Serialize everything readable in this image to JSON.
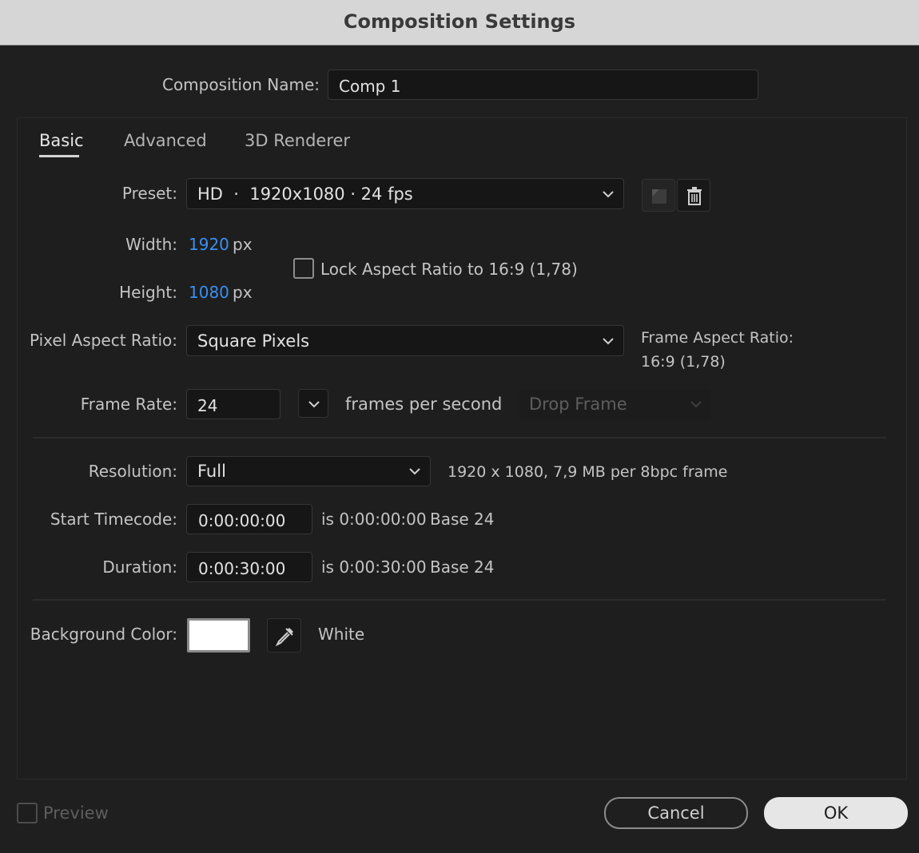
{
  "window": {
    "title": "Composition Settings"
  },
  "name_row": {
    "label": "Composition Name:",
    "value": "Comp 1"
  },
  "tabs": [
    {
      "label": "Basic",
      "active": true
    },
    {
      "label": "Advanced",
      "active": false
    },
    {
      "label": "3D Renderer",
      "active": false
    }
  ],
  "preset": {
    "label": "Preset:",
    "value": "HD  ·  1920x1080 · 24 fps"
  },
  "width": {
    "label": "Width:",
    "value": "1920",
    "unit": "px"
  },
  "height": {
    "label": "Height:",
    "value": "1080",
    "unit": "px"
  },
  "lock_aspect": {
    "label": "Lock Aspect Ratio to 16:9 (1,78)",
    "checked": false
  },
  "pixel_aspect": {
    "label": "Pixel Aspect Ratio:",
    "value": "Square Pixels",
    "frame_aspect_label": "Frame Aspect Ratio:",
    "frame_aspect_value": "16:9 (1,78)"
  },
  "frame_rate": {
    "label": "Frame Rate:",
    "value": "24",
    "unit": "frames per second",
    "drop_frame": "Drop Frame"
  },
  "resolution": {
    "label": "Resolution:",
    "value": "Full",
    "info": "1920 x 1080, 7,9 MB per 8bpc frame"
  },
  "start_timecode": {
    "label": "Start Timecode:",
    "value": "0:00:00:00",
    "is_text": "is 0:00:00:00",
    "base": "Base 24"
  },
  "duration": {
    "label": "Duration:",
    "value": "0:00:30:00",
    "is_text": "is 0:00:30:00",
    "base": "Base 24"
  },
  "background": {
    "label": "Background Color:",
    "color_name": "White",
    "swatch": "#ffffff"
  },
  "footer": {
    "preview_label": "Preview",
    "preview_checked": false,
    "cancel_label": "Cancel",
    "ok_label": "OK"
  },
  "icons": {
    "new_preset": "new-preset-icon",
    "delete_preset": "trash-icon",
    "eyedropper": "eyedropper-icon",
    "dropdown": "chevron-down-icon"
  },
  "colors": {
    "accent_value": "#3b8ff0",
    "ok_button": "#e6e6e6",
    "dialog_bg": "#1f1f1f"
  }
}
